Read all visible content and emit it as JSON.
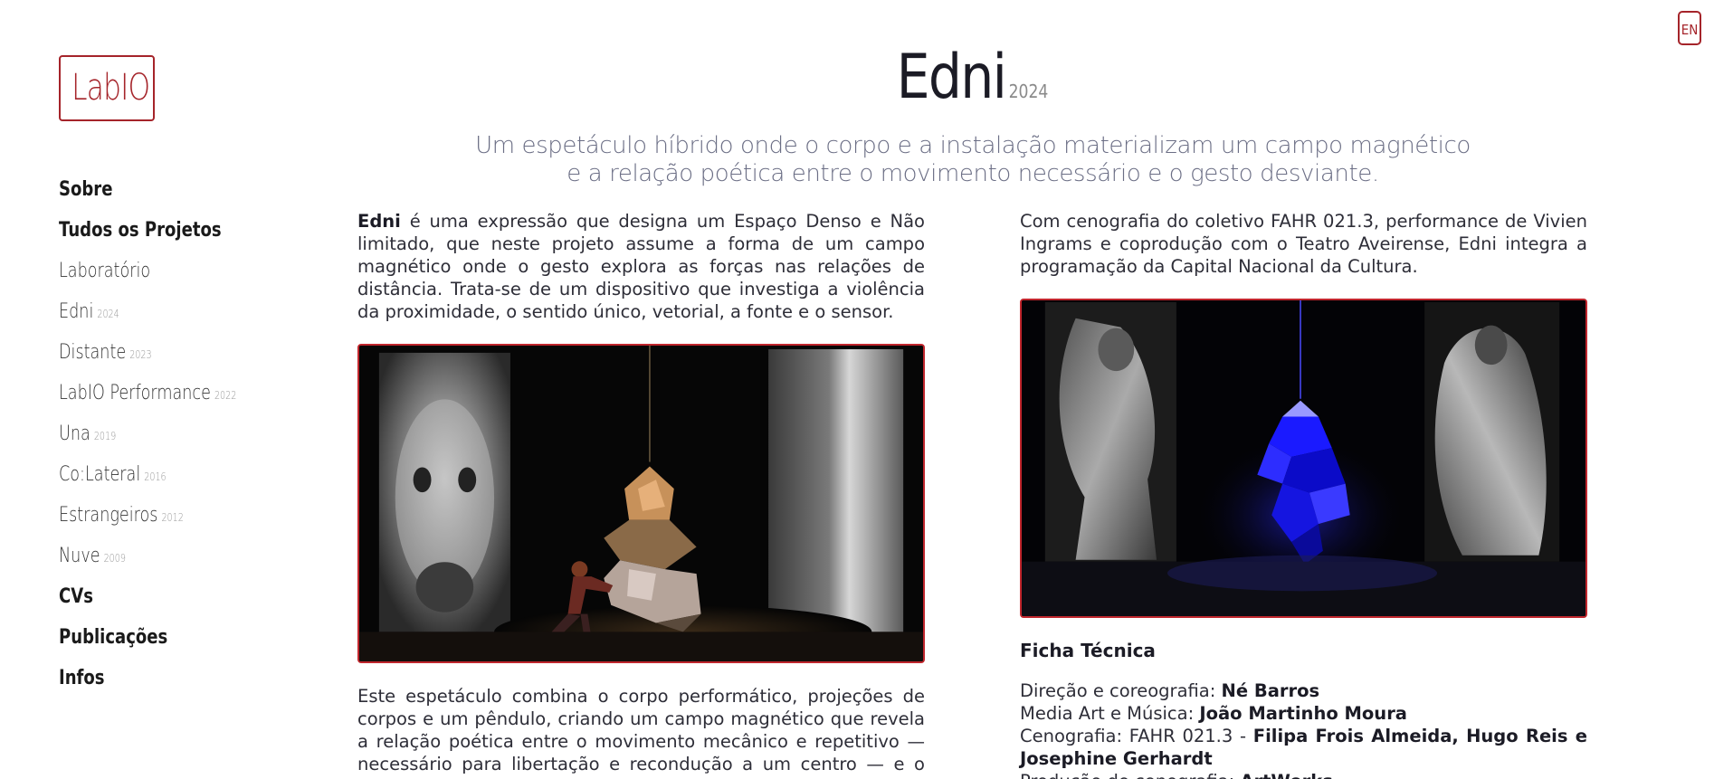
{
  "language_button": "EN",
  "logo": "LabIO",
  "nav": {
    "items": [
      {
        "label": "Sobre",
        "year": ""
      },
      {
        "label": "Tudos os Projetos",
        "year": ""
      },
      {
        "label": "Laboratório",
        "year": ""
      },
      {
        "label": "Edni",
        "year": "2024"
      },
      {
        "label": "Distante",
        "year": "2023"
      },
      {
        "label": "LabIO Performance",
        "year": "2022"
      },
      {
        "label": "Una",
        "year": "2019"
      },
      {
        "label": "Co:Lateral",
        "year": "2016"
      },
      {
        "label": "Estrangeiros",
        "year": "2012"
      },
      {
        "label": "Nuve",
        "year": "2009"
      },
      {
        "label": "CVs",
        "year": ""
      },
      {
        "label": "Publicações",
        "year": ""
      },
      {
        "label": "Infos",
        "year": ""
      }
    ]
  },
  "project": {
    "title": "Edni",
    "year": "2024",
    "subtitle": "Um espetáculo híbrido onde o corpo e a instalação materializam um campo magnético e a relação poética entre o movimento necessário e o gesto desviante.",
    "intro_bold": "Edni",
    "intro_rest": " é uma expressão que designa um Espaço Denso e Não limitado, que neste projeto assume a forma de um campo magnético onde o gesto explora as forças nas relações de distância. Trata-se de um dispositivo que investiga a violência da proximidade, o sentido único, vetorial, a fonte e o sensor.",
    "right_paragraph": "Com cenografia do coletivo FAHR 021.3, performance de Vivien Ingrams e coprodução com o Teatro Aveirense, Edni integra a programação da Capital Nacional da Cultura.",
    "bottom_paragraph": "Este espetáculo combina o corpo performático, projeções de corpos e um pêndulo, criando um campo magnético que revela a relação poética entre o movimento mecânico e repetitivo — necessário para libertação e recondução a um centro — e o gesto"
  },
  "ficha": {
    "title": "Ficha Técnica",
    "rows": [
      {
        "label": "Direção e coreografia: ",
        "value": "Né Barros"
      },
      {
        "label": "Media Art e Música: ",
        "value": "João Martinho Moura"
      },
      {
        "label": "Cenografia: FAHR 021.3 - ",
        "value": "Filipa Frois Almeida, Hugo Reis e Josephine Gerhardt"
      },
      {
        "label": "Produção de cenografia: ",
        "value": "ArtWorks"
      }
    ]
  },
  "colors": {
    "accent": "#a5242a",
    "subtitle": "#6b6e85",
    "text": "#2e2e38"
  }
}
